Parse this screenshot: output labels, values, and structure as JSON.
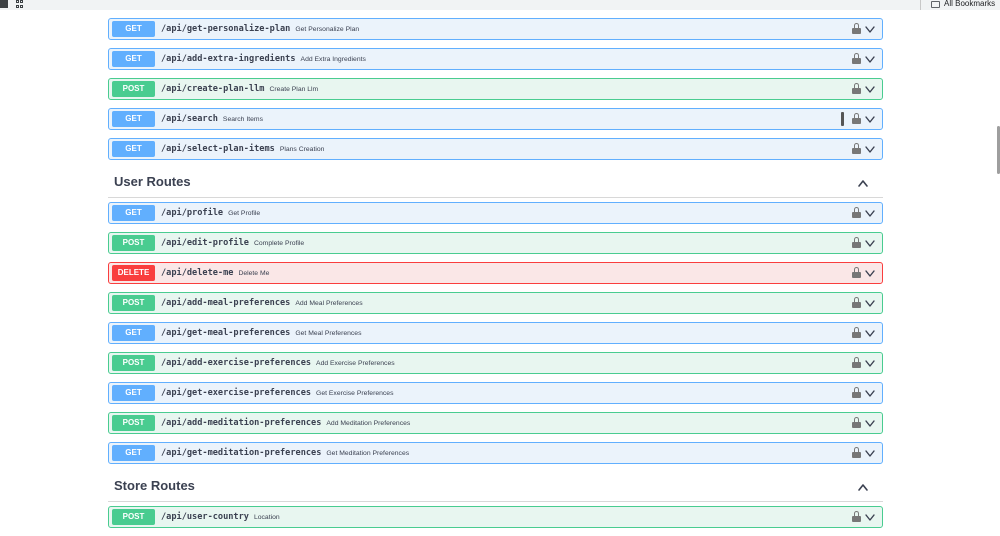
{
  "browser": {
    "bookmarks_label": "All Bookmarks"
  },
  "colors": {
    "get": "#61affe",
    "post": "#49cc90",
    "delete": "#f93e3e"
  },
  "icons": {
    "lock": "lock-icon",
    "expand": "chevron-down-icon",
    "collapse": "chevron-up-icon"
  },
  "groups": [
    {
      "title": null,
      "operations": [
        {
          "method": "GET",
          "path": "/api/get-personalize-plan",
          "summary": "Get Personalize Plan"
        },
        {
          "method": "GET",
          "path": "/api/add-extra-ingredients",
          "summary": "Add Extra Ingredients"
        },
        {
          "method": "POST",
          "path": "/api/create-plan-llm",
          "summary": "Create Plan Llm"
        },
        {
          "method": "GET",
          "path": "/api/search",
          "summary": "Search Items"
        },
        {
          "method": "GET",
          "path": "/api/select-plan-items",
          "summary": "Plans Creation"
        }
      ]
    },
    {
      "title": "User Routes",
      "operations": [
        {
          "method": "GET",
          "path": "/api/profile",
          "summary": "Get Profile"
        },
        {
          "method": "POST",
          "path": "/api/edit-profile",
          "summary": "Complete Profile"
        },
        {
          "method": "DELETE",
          "path": "/api/delete-me",
          "summary": "Delete Me"
        },
        {
          "method": "POST",
          "path": "/api/add-meal-preferences",
          "summary": "Add Meal Preferences"
        },
        {
          "method": "GET",
          "path": "/api/get-meal-preferences",
          "summary": "Get Meal Preferences"
        },
        {
          "method": "POST",
          "path": "/api/add-exercise-preferences",
          "summary": "Add Exercise Preferences"
        },
        {
          "method": "GET",
          "path": "/api/get-exercise-preferences",
          "summary": "Get Exercise Preferences"
        },
        {
          "method": "POST",
          "path": "/api/add-meditation-preferences",
          "summary": "Add Meditation Preferences"
        },
        {
          "method": "GET",
          "path": "/api/get-meditation-preferences",
          "summary": "Get Meditation Preferences"
        }
      ]
    },
    {
      "title": "Store Routes",
      "operations": [
        {
          "method": "POST",
          "path": "/api/user-country",
          "summary": "Location"
        }
      ]
    }
  ]
}
